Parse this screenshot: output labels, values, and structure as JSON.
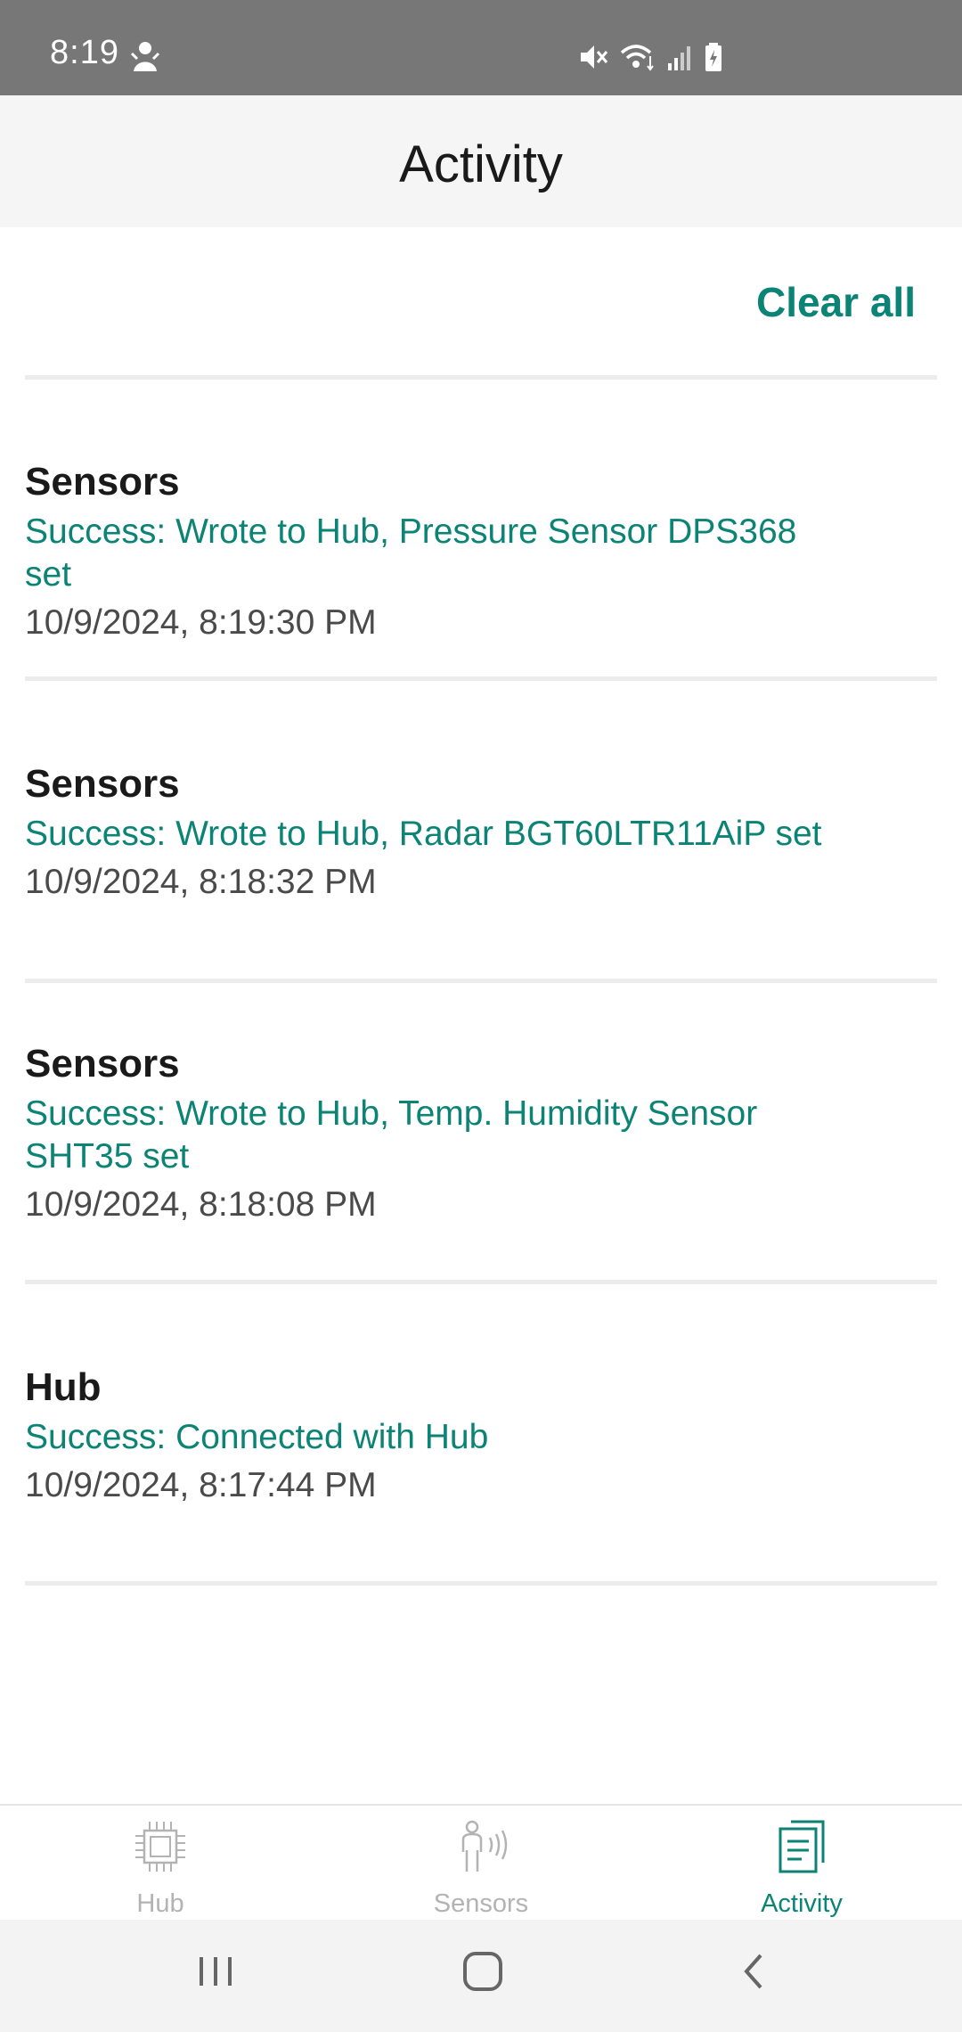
{
  "status_bar": {
    "time": "8:19"
  },
  "header": {
    "title": "Activity"
  },
  "actions": {
    "clear_all_label": "Clear all"
  },
  "entries": [
    {
      "title": "Sensors",
      "message": "Success: Wrote to Hub, Pressure Sensor DPS368 set",
      "timestamp": "10/9/2024, 8:19:30 PM"
    },
    {
      "title": "Sensors",
      "message": "Success: Wrote to Hub, Radar BGT60LTR11AiP set",
      "timestamp": "10/9/2024, 8:18:32 PM"
    },
    {
      "title": "Sensors",
      "message": "Success: Wrote to Hub, Temp. Humidity Sensor SHT35 set",
      "timestamp": "10/9/2024, 8:18:08 PM"
    },
    {
      "title": "Hub",
      "message": "Success: Connected with Hub",
      "timestamp": "10/9/2024, 8:17:44 PM"
    }
  ],
  "bottom_nav": {
    "items": [
      {
        "label": "Hub",
        "icon": "chip-icon",
        "active": false
      },
      {
        "label": "Sensors",
        "icon": "person-waves-icon",
        "active": false
      },
      {
        "label": "Activity",
        "icon": "document-list-icon",
        "active": true
      }
    ]
  },
  "colors": {
    "accent": "#0b8375",
    "status_bar": "#777777",
    "header_bg": "#f5f5f5",
    "inactive": "#b3b3b3"
  }
}
